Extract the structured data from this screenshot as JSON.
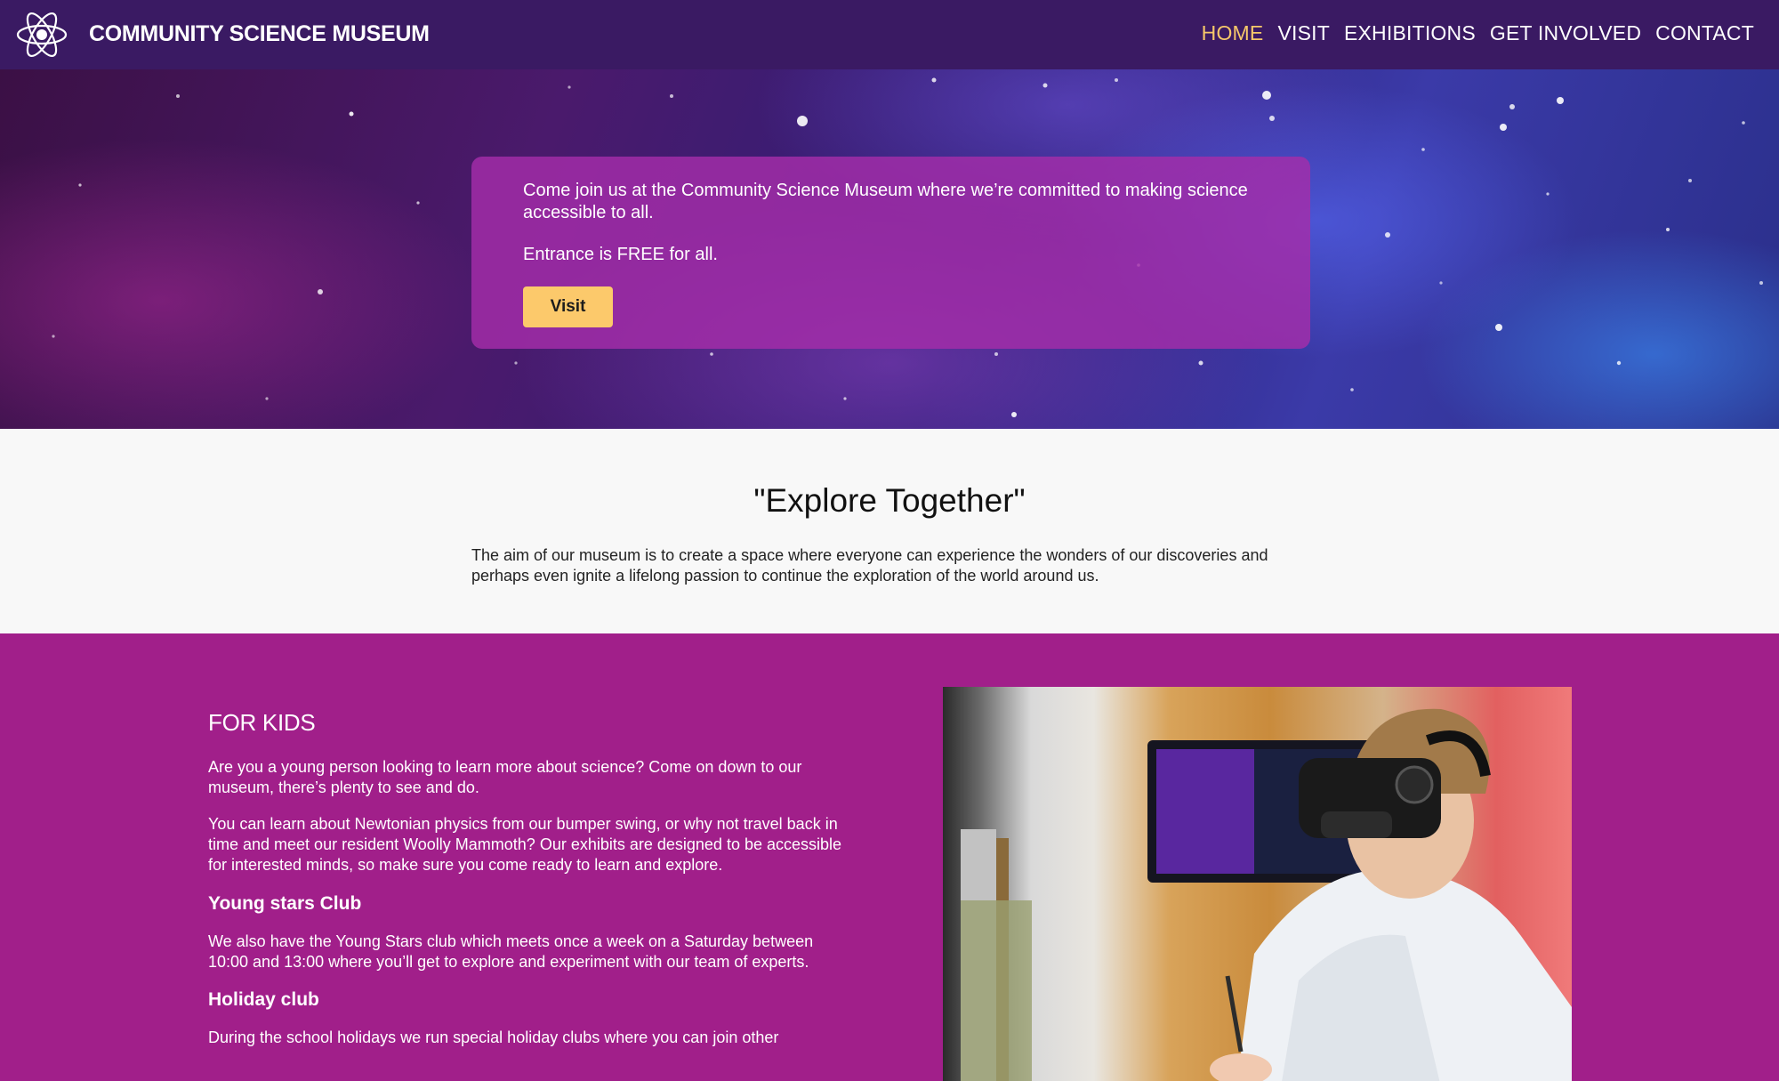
{
  "header": {
    "brand": "COMMUNITY SCIENCE MUSEUM",
    "logo_icon": "atom-icon",
    "nav": [
      {
        "label": "HOME",
        "active": true
      },
      {
        "label": "VISIT",
        "active": false
      },
      {
        "label": "EXHIBITIONS",
        "active": false
      },
      {
        "label": "GET INVOLVED",
        "active": false
      },
      {
        "label": "CONTACT",
        "active": false
      }
    ]
  },
  "hero": {
    "intro": "Come join us at the Community Science Museum where we’re committed to making science accessible to all.",
    "entrance": "Entrance is FREE for all.",
    "button_label": "Visit"
  },
  "explore": {
    "heading": "\"Explore Together\"",
    "text": "The aim of our museum is to create a space where everyone can experience the wonders of our discoveries and perhaps even ignite a lifelong passion to continue the exploration of the world around us."
  },
  "kids": {
    "title": "FOR KIDS",
    "p1": "Are you a young person looking to learn more about science? Come on down to our museum, there’s plenty to see and do.",
    "p2": "You can learn about Newtonian physics from our bumper swing, or why not travel back in time and meet our resident Woolly Mammoth? Our exhibits are designed to be accessible for interested minds, so make sure you come ready to learn and explore.",
    "young_stars_heading": "Young stars Club",
    "p3": "We also have the Young Stars club which meets once a week on a Saturday between 10:00 and 13:00 where you’ll get to explore and experiment with our team of experts.",
    "holiday_heading": "Holiday club",
    "p4": "During the school holidays we run special holiday clubs where you can join other"
  },
  "colors": {
    "header_bg": "#3a1a63",
    "nav_active": "#f6c86a",
    "hero_box": "#a52daa",
    "button": "#fcc96b",
    "kids_bg": "#a11f8a"
  }
}
